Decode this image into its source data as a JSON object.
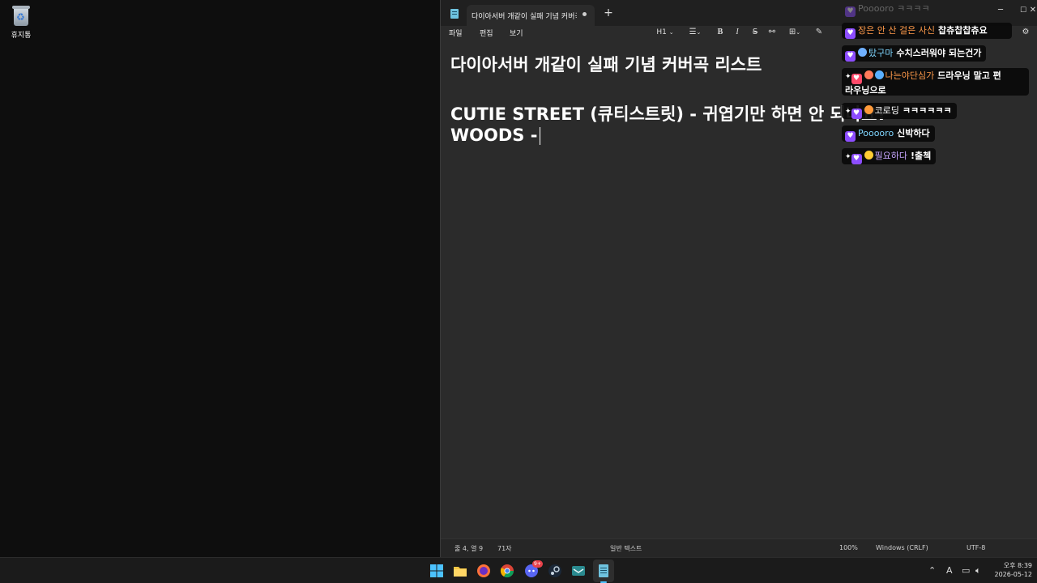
{
  "desktop": {
    "recycle_bin_label": "휴지통"
  },
  "notepad": {
    "tab_title": "다이아서버 개같이 실패 기념 커버곡",
    "menu": [
      "파일",
      "편집",
      "보기"
    ],
    "toolbar": {
      "heading": "H1",
      "bold": "B",
      "italic": "I",
      "strike": "S"
    },
    "lines": [
      "다이아서버 개같이 실패 기념 커버곡 리스트",
      "CUTIE STREET (큐티스트릿) - 귀엽기만 하면 안 되나요?",
      "WOODS - "
    ],
    "status": {
      "position": "줄 4, 열 9",
      "chars": "71자",
      "format": "일반 텍스트",
      "zoom": "100%",
      "line_ending": "Windows (CRLF)",
      "encoding": "UTF-8"
    }
  },
  "chat": [
    {
      "nick": "Pooooro",
      "text": "ㅋㅋㅋㅋ",
      "nick_color": "#b8b8b8"
    },
    {
      "nick": "장은 안 산 걸은 사신",
      "text": "찹츄찹찹츄요",
      "nick_color": "#ff9a4a"
    },
    {
      "nick": "탔구마",
      "text": "수치스러워야 되는건가",
      "nick_color": "#7fd6ff"
    },
    {
      "nick": "나는야단심가",
      "text": "드라우닝 말고 편",
      "text2": "라우닝으로",
      "nick_color": "#ff9a4a"
    },
    {
      "nick": "코로딩",
      "text": "ㅋㅋㅋㅋㅋㅋ",
      "nick_color": "#ffffff"
    },
    {
      "nick": "Pooooro",
      "text": "신박하다",
      "nick_color": "#7fd6ff"
    },
    {
      "nick": "필요하다",
      "text": "!출첵",
      "nick_color": "#c8a6ff"
    }
  ],
  "taskbar": {
    "clock_time": "오후 8:39",
    "clock_date": "2026-05-12",
    "discord_badge": "9+",
    "ime": "A"
  }
}
